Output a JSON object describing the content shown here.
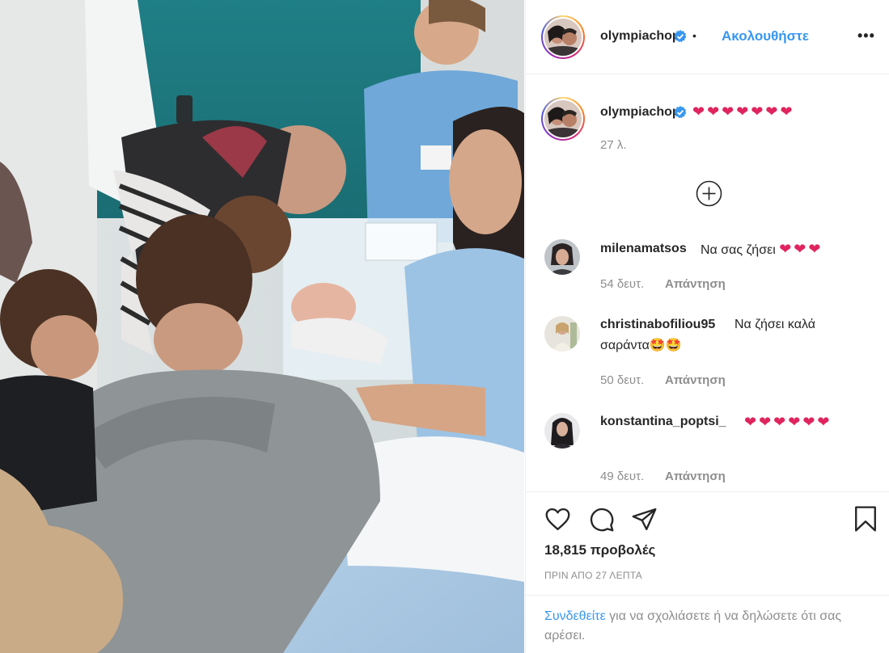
{
  "post": {
    "username": "olympiachop",
    "follow_label": "Ακολουθήστε",
    "separator": "•",
    "more_label": "•••"
  },
  "caption": {
    "username": "olympiachop",
    "text": "❤❤❤❤❤❤❤",
    "time": "27 λ."
  },
  "comments": [
    {
      "username": "milenamatsos",
      "text": "Να σας ζήσει",
      "emoji": "❤❤❤",
      "time": "54 δευτ.",
      "reply": "Απάντηση"
    },
    {
      "username": "christinabofiliou95",
      "text": "Να ζήσει καλά",
      "text2": "σαράντα",
      "emoji": "🤩🤩",
      "time": "50 δευτ.",
      "reply": "Απάντηση"
    },
    {
      "username": "konstantina_poptsi_",
      "text": "",
      "emoji": "❤❤❤❤❤❤",
      "time": "49 δευτ.",
      "reply": "Απάντηση"
    }
  ],
  "stats": {
    "views": "18,815 προβολές",
    "posted": "ΠΡΙΝ ΑΠΟ 27 ΛΕΠΤΑ"
  },
  "login": {
    "link": "Συνδεθείτε",
    "rest": "για να σχολιάσετε ή να δηλώσετε ότι σας αρέσει."
  },
  "icons": {
    "verified": "verified-badge-icon",
    "like": "heart-outline-icon",
    "comment": "comment-bubble-icon",
    "share": "paper-plane-icon",
    "save": "bookmark-icon",
    "load_more": "plus-circle-icon"
  },
  "colors": {
    "link_blue": "#3897f0",
    "verified_blue": "#3897f0",
    "heart_red": "#e0245e",
    "muted": "#8e8e8e"
  }
}
